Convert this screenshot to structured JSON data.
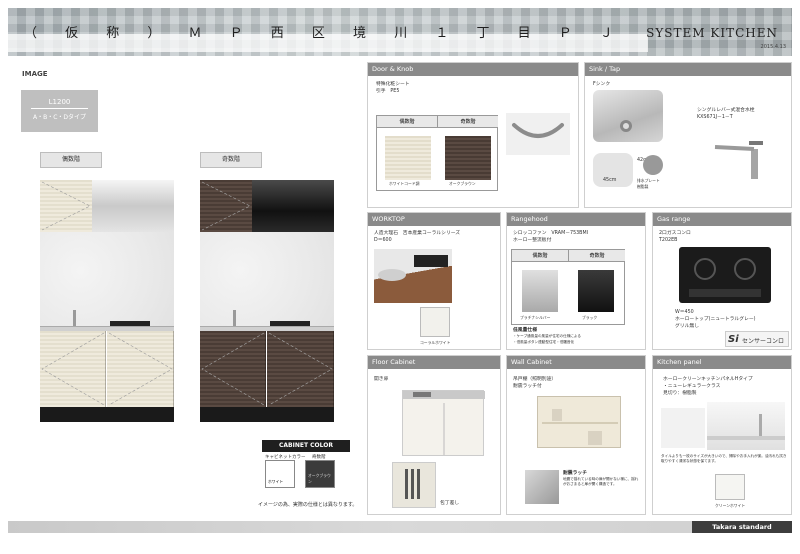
{
  "header": {
    "project_title": "（ 仮 称 ） Ｍ Ｐ 西 区 境 川 １ 丁 目 Ｐ Ｊ",
    "system_label": "SYSTEM KITCHEN",
    "date": "2015.4.13"
  },
  "left": {
    "image_label": "IMAGE",
    "size_line1": "L1200",
    "size_line2": "A・B・C・Dタイプ",
    "even_label": "偶数階",
    "odd_label": "奇数階"
  },
  "cabinet_color": {
    "title": "CABINET COLOR",
    "cabinet_label": "キャビネットカラー",
    "even_floor_label": "偶数階",
    "odd_floor_label": "奇数階",
    "white_name": "ホワイト",
    "dark_name": "オークブラウン",
    "disclaimer": "イメージの為、実際の仕様とは異なります。"
  },
  "panels": {
    "door_knob": {
      "title": "Door & Knob",
      "line1": "特殊化粧シート",
      "line2": "引手　PE5",
      "even": "偶数階",
      "odd": "奇数階",
      "even_color": "ホワイトコード調",
      "odd_color": "オークブラウン"
    },
    "sink_tap": {
      "title": "Sink / Tap",
      "sink_name": "Fシンク",
      "tap_name": "シングルレバー式混合水栓",
      "tap_model": "KXS671J－1－T",
      "dim_a": "42cm",
      "dim_b": "45cm",
      "plate_label": "排水プレート",
      "plate_sub": "樹脂製"
    },
    "worktop": {
      "title": "WORKTOP",
      "line1": "人造大理石　吉本産業コーラルシリーズ",
      "line2": "D＝600",
      "swatch_name": "コーラルホワイト"
    },
    "rangehood": {
      "title": "Rangehood",
      "line1": "シロッコファン　VRAM－753BMI",
      "line2": "ホーロー整流板付",
      "even": "偶数階",
      "odd": "奇数階",
      "even_color": "プラチナシルバー",
      "odd_color": "ブラック",
      "note1": "低風量仕様",
      "note2": "・ケーブ通風量の風量が住宅の仕様による",
      "note3": "・低風量ボタン連動型住宅・低騒音化"
    },
    "gas_range": {
      "title": "Gas range",
      "line1": "2口ガスコンロ",
      "line2": "T202EB",
      "spec1": "W＝450",
      "spec2": "ホーロートップ(ニュートラルグレー)",
      "spec3": "グリル無し",
      "sensor_si": "Si",
      "sensor_text": "センサーコンロ"
    },
    "floor_cabinet": {
      "title": "Floor Cabinet",
      "line1": "開き扉",
      "caption": "包丁差し"
    },
    "wall_cabinet": {
      "title": "Wall Cabinet",
      "line1": "吊戸棚（照明別途）",
      "line2": "耐震ラッチ付",
      "latch": "耐震ラッチ",
      "latch_desc": "地震で揺れている時の扉が開かない様に、揺れがおさまると扉が開く構造です。"
    },
    "kitchen_panel": {
      "title": "Kitchen panel",
      "line1": "ホーロークリーンキッチンパネルHタイプ",
      "line2": "・ニューレギュラークラス",
      "line3": "見切り：樹脂製",
      "desc": "タイルよりも一枚のサイズが大きいので、掃除やお手入れが楽。油汚れも拭き取りやすく清潔な状態を保てます。",
      "swatch_name": "クリーンホワイト"
    }
  },
  "footer": {
    "brand": "Takara standard"
  },
  "colors": {
    "panel_head": "#8a8a8a",
    "light_door": "#efeadc",
    "dark_door": "#4a3c35",
    "plinth": "#1a1a1a"
  }
}
